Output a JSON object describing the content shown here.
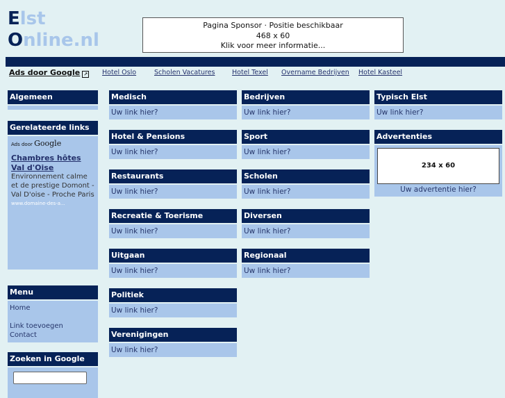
{
  "logo": {
    "line1_cap": "E",
    "line1_rest": "lst",
    "line2_cap": "O",
    "line2_rest": "nline.nl"
  },
  "sponsor": {
    "line1": "Pagina Sponsor · Positie beschikbaar",
    "line2": "468 x 60",
    "line3": "Klik voor meer informatie..."
  },
  "adlinks": {
    "google_label": "Ads door Google",
    "links": [
      "Hotel Oslo",
      "Scholen Vacatures",
      "Hotel Texel",
      "Overname Bedrijven",
      "Hotel Kasteel"
    ]
  },
  "left": {
    "algemeen": {
      "title": "Algemeen"
    },
    "related": {
      "title": "Gerelateerde links",
      "adsby": "Ads door",
      "google": "Google",
      "ad_title": "Chambres hôtes Val d'Oise",
      "ad_desc": "Environnement calme et de prestige Domont - Val D'oise - Proche Paris",
      "ad_url": "www.domaine-des-a..."
    },
    "menu": {
      "title": "Menu",
      "items": [
        "Home",
        "",
        "Link toevoegen",
        "Contact"
      ]
    },
    "search": {
      "title": "Zoeken in Google",
      "value": ""
    }
  },
  "categories": {
    "col1": [
      {
        "title": "Medisch",
        "link": "Uw link hier?"
      },
      {
        "title": "Hotel & Pensions",
        "link": "Uw link hier?"
      },
      {
        "title": "Restaurants",
        "link": "Uw link hier?"
      },
      {
        "title": "Recreatie & Toerisme",
        "link": "Uw link hier?"
      },
      {
        "title": "Uitgaan",
        "link": "Uw link hier?"
      },
      {
        "title": "Politiek",
        "link": "Uw link hier?"
      },
      {
        "title": "Verenigingen",
        "link": "Uw link hier?"
      }
    ],
    "col2": [
      {
        "title": "Bedrijven",
        "link": "Uw link hier?"
      },
      {
        "title": "Sport",
        "link": "Uw link hier?"
      },
      {
        "title": "Scholen",
        "link": "Uw link hier?"
      },
      {
        "title": "Diversen",
        "link": "Uw link hier?"
      },
      {
        "title": "Regionaal",
        "link": "Uw link hier?"
      }
    ],
    "col3": [
      {
        "title": "Typisch Elst",
        "link": "Uw link hier?"
      }
    ]
  },
  "advertenties": {
    "title": "Advertenties",
    "banner": "234 x 60",
    "caption": "Uw advertentie hier?"
  }
}
